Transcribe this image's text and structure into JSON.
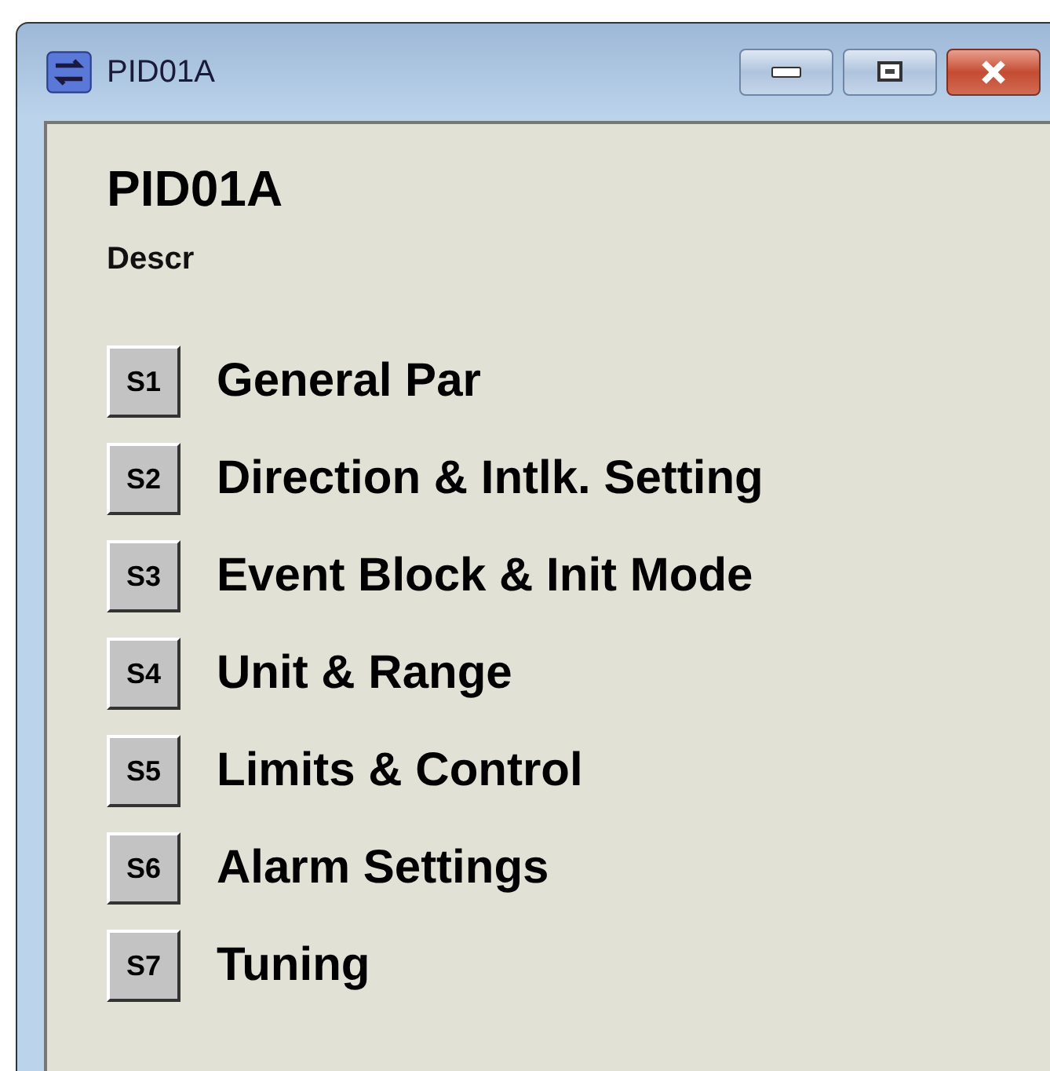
{
  "window": {
    "title": "PID01A"
  },
  "heading": "PID01A",
  "description": "Descr",
  "sections": [
    {
      "button": "S1",
      "label": "General Par"
    },
    {
      "button": "S2",
      "label": "Direction & Intlk. Setting"
    },
    {
      "button": "S3",
      "label": "Event Block & Init Mode"
    },
    {
      "button": "S4",
      "label": "Unit & Range"
    },
    {
      "button": "S5",
      "label": "Limits & Control"
    },
    {
      "button": "S6",
      "label": "Alarm Settings"
    },
    {
      "button": "S7",
      "label": "Tuning"
    }
  ]
}
